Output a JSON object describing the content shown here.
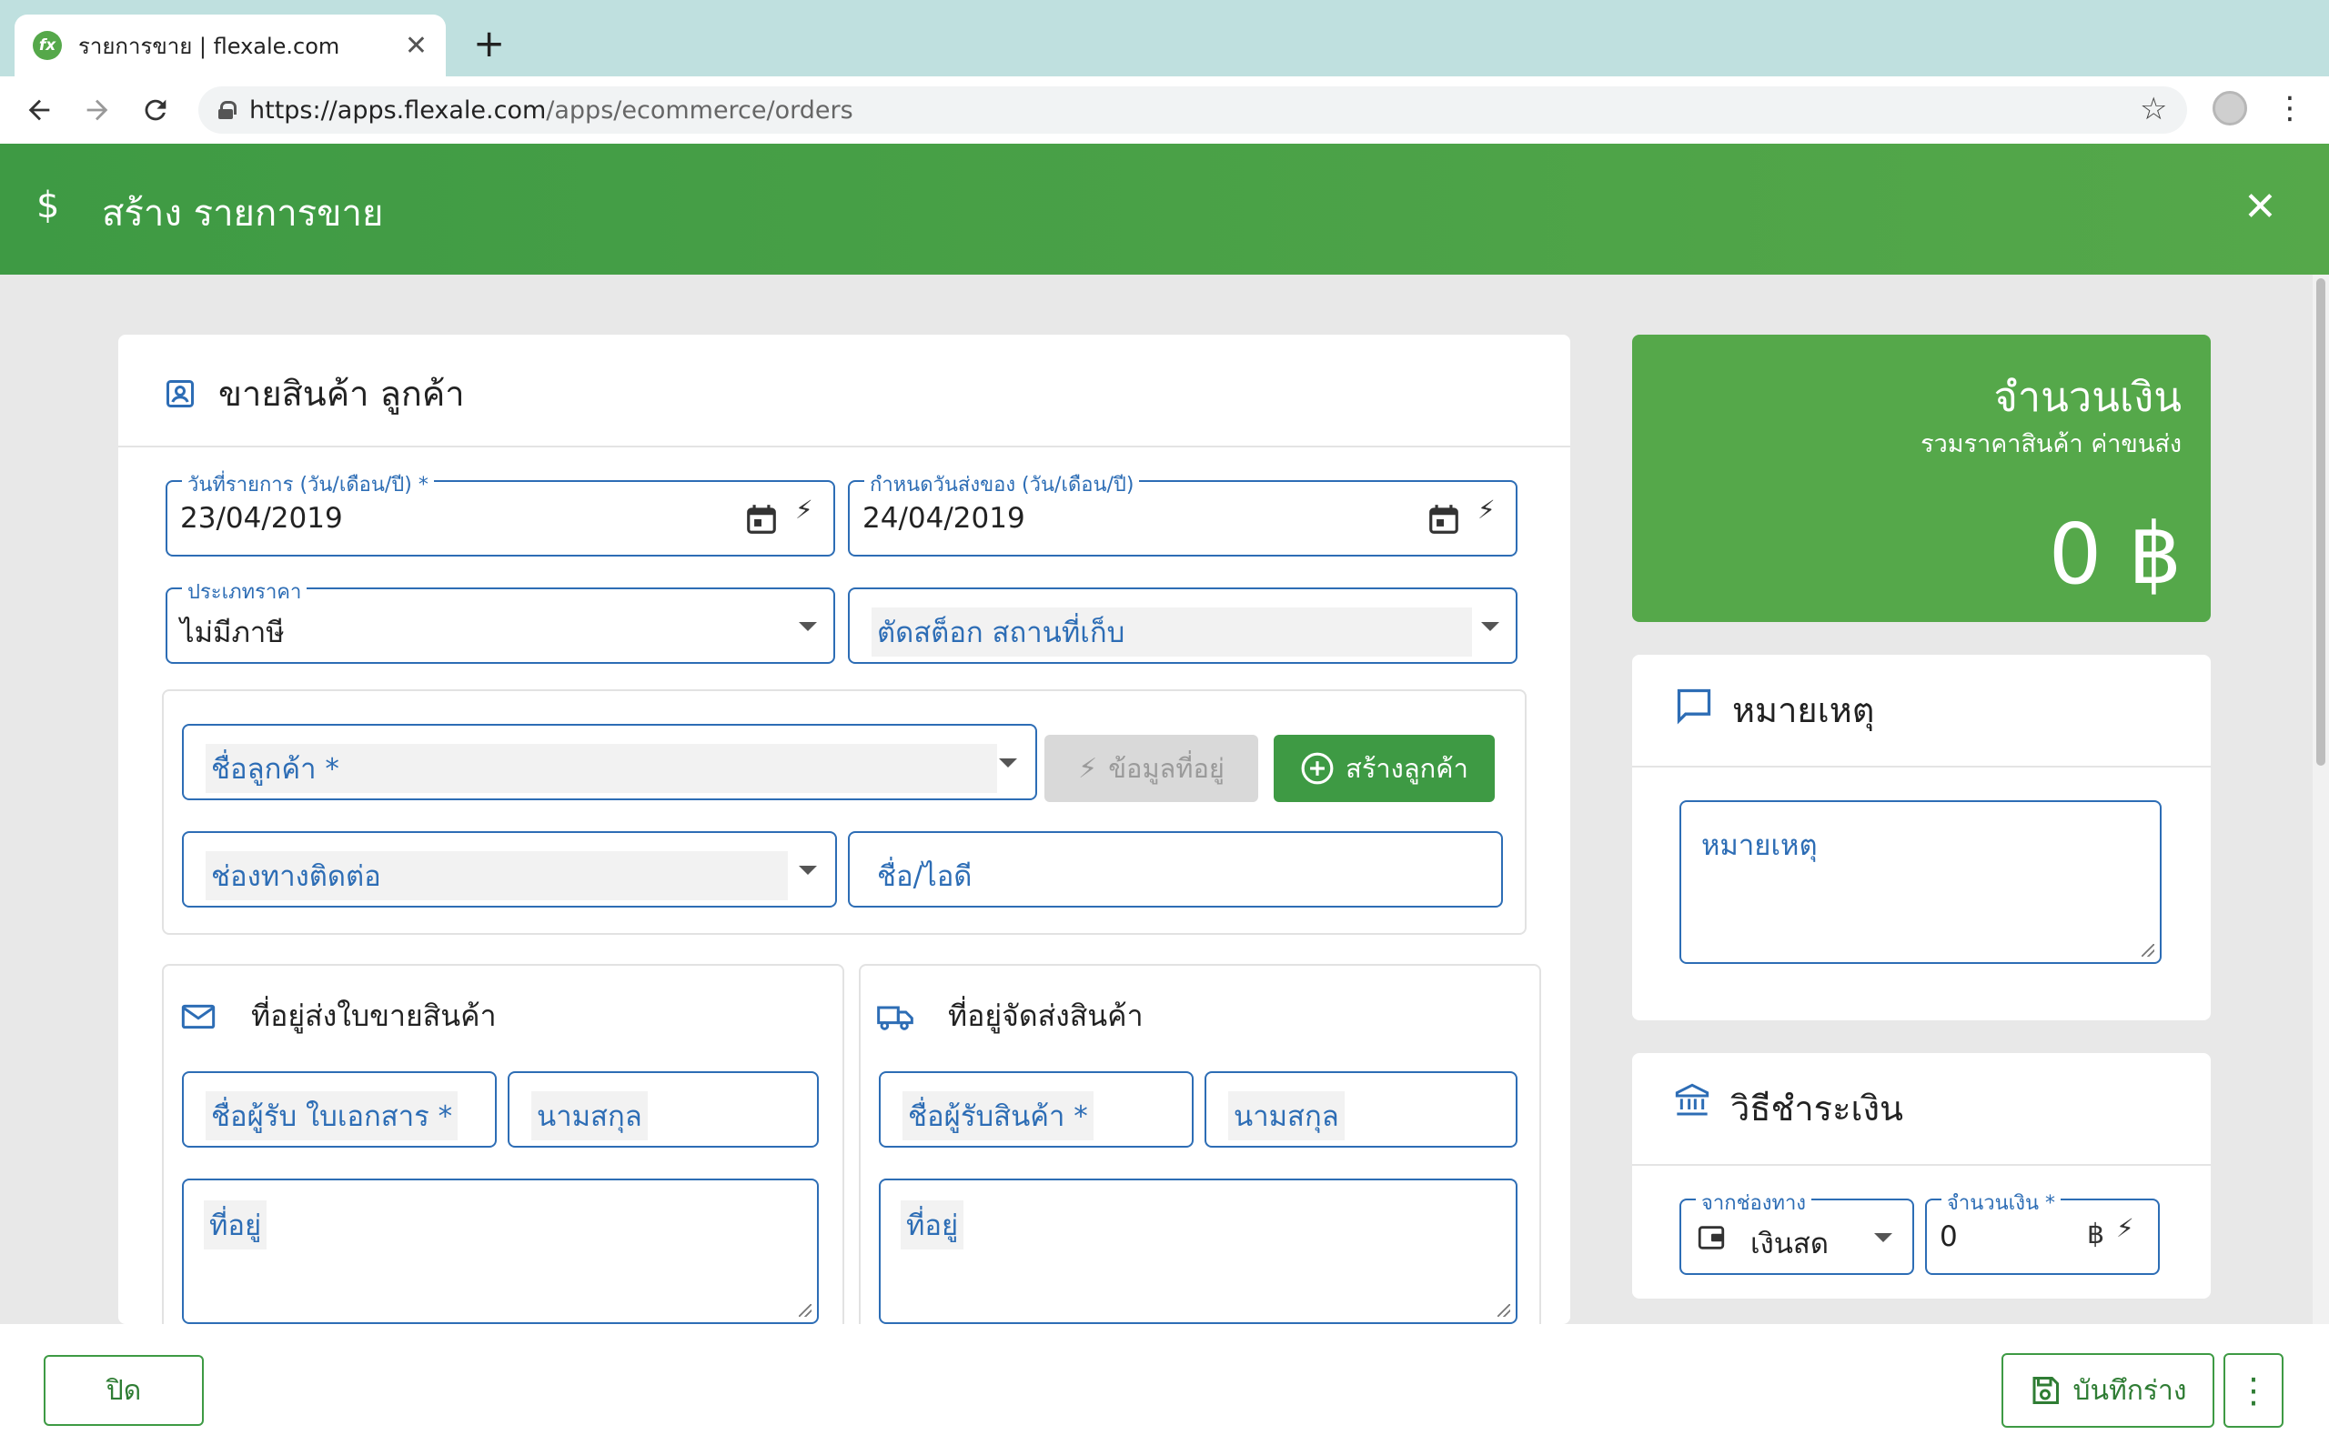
{
  "browser": {
    "tab_title": "รายการขาย | flexale.com",
    "favicon_text": "fx",
    "url_host": "https://apps.flexale.com",
    "url_path": "/apps/ecommerce/orders"
  },
  "header": {
    "currency_symbol": "$",
    "title": "สร้าง รายการขาย",
    "close": "✕"
  },
  "sale_card": {
    "title": "ขายสินค้า ลูกค้า",
    "order_date": {
      "label": "วันที่รายการ (วัน/เดือน/ปี) *",
      "value": "23/04/2019"
    },
    "delivery_date": {
      "label": "กำหนดวันส่งของ (วัน/เดือน/ปี)",
      "value": "24/04/2019"
    },
    "price_type": {
      "label": "ประเภทราคา",
      "value": "ไม่มีภาษี"
    },
    "stock_location": {
      "placeholder": "ตัดสต็อก สถานที่เก็บ"
    },
    "customer": {
      "name_placeholder": "ชื่อลูกค้า *",
      "address_info_button": "ข้อมูลที่อยู่",
      "create_customer_button": "สร้างลูกค้า",
      "contact_channel_placeholder": "ช่องทางติดต่อ",
      "name_id_placeholder": "ชื่อ/ไอดี"
    },
    "billing": {
      "title": "ที่อยู่ส่งใบขายสินค้า",
      "recipient_placeholder": "ชื่อผู้รับ ใบเอกสาร *",
      "surname_placeholder": "นามสกุล",
      "address_placeholder": "ที่อยู่"
    },
    "shipping": {
      "title": "ที่อยู่จัดส่งสินค้า",
      "recipient_placeholder": "ชื่อผู้รับสินค้า *",
      "surname_placeholder": "นามสกุล",
      "address_placeholder": "ที่อยู่"
    }
  },
  "amount": {
    "title": "จำนวนเงิน",
    "subtitle": "รวมราคาสินค้า ค่าขนส่ง",
    "value": "0 ฿"
  },
  "note": {
    "title": "หมายเหตุ",
    "placeholder": "หมายเหตุ"
  },
  "payment": {
    "title": "วิธีชำระเงิน",
    "channel": {
      "label": "จากช่องทาง",
      "value": "เงินสด"
    },
    "amount": {
      "label": "จำนวนเงิน *",
      "value": "0",
      "currency": "฿"
    }
  },
  "footer": {
    "close_button": "ปิด",
    "save_draft_button": "บันทึกร่าง"
  },
  "colors": {
    "brand_green": "#55a84a",
    "brand_green_dark": "#3e9a44",
    "field_blue": "#2d6db5"
  }
}
